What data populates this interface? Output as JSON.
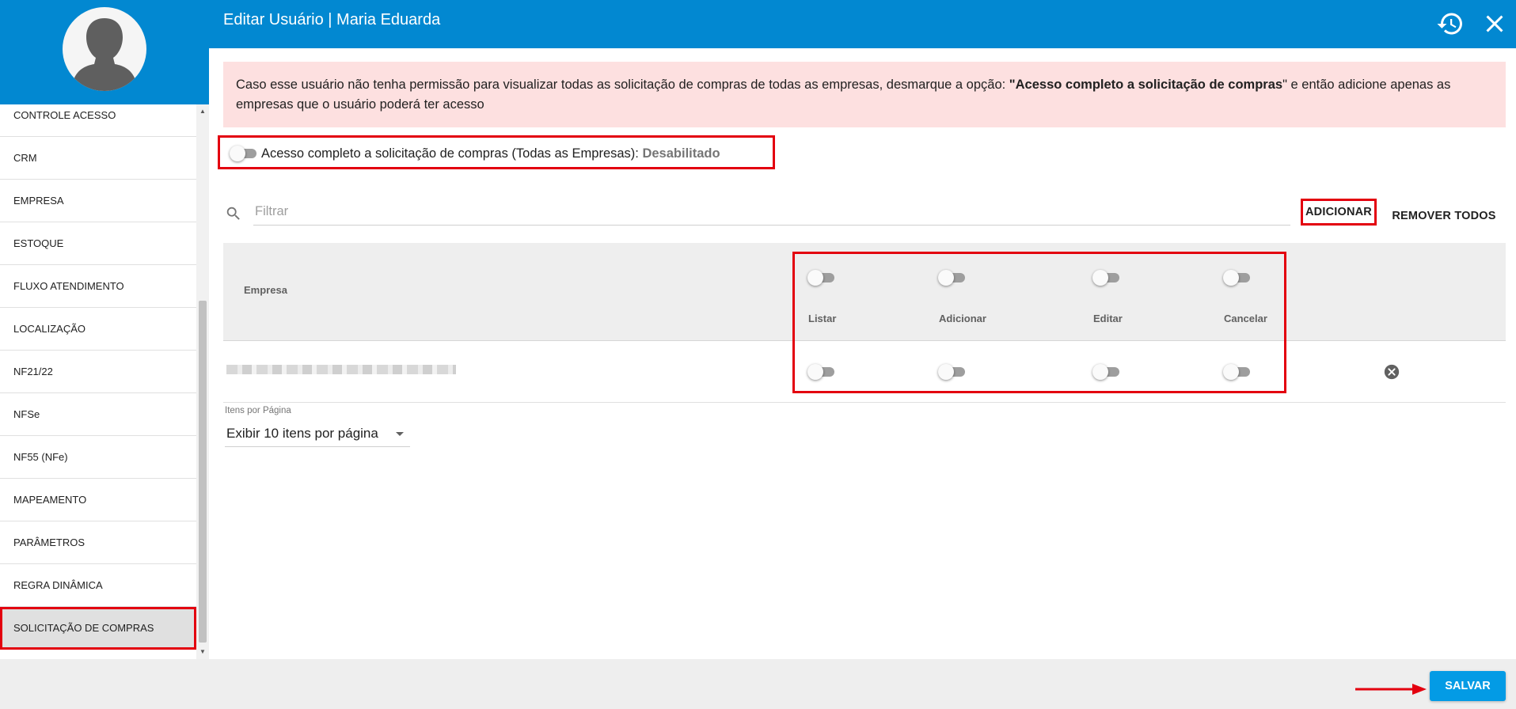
{
  "header": {
    "title": "Editar Usuário | Maria Eduarda",
    "history_icon": "history-icon",
    "close_icon": "close-icon"
  },
  "sidebar": {
    "items": [
      {
        "label": "CONTROLE ACESSO",
        "active": false
      },
      {
        "label": "CRM",
        "active": false
      },
      {
        "label": "EMPRESA",
        "active": false
      },
      {
        "label": "ESTOQUE",
        "active": false
      },
      {
        "label": "FLUXO ATENDIMENTO",
        "active": false
      },
      {
        "label": "LOCALIZAÇÃO",
        "active": false
      },
      {
        "label": "NF21/22",
        "active": false
      },
      {
        "label": "NFSe",
        "active": false
      },
      {
        "label": "NF55 (NFe)",
        "active": false
      },
      {
        "label": "MAPEAMENTO",
        "active": false
      },
      {
        "label": "PARÂMETROS",
        "active": false
      },
      {
        "label": "REGRA DINÂMICA",
        "active": false
      },
      {
        "label": "SOLICITAÇÃO DE COMPRAS",
        "active": true
      }
    ]
  },
  "alert": {
    "text_before": "Caso esse usuário não tenha permissão para visualizar todas as solicitação de compras de todas as empresas, desmarque a opção: ",
    "text_bold": "\"Acesso completo a solicitação de compras",
    "text_after": "\" e então adicione apenas as empresas que o usuário poderá ter acesso"
  },
  "full_access": {
    "label": "Acesso completo a solicitação de compras (Todas as Empresas): ",
    "state": "Desabilitado",
    "enabled": false
  },
  "filter": {
    "placeholder": "Filtrar",
    "value": ""
  },
  "actions": {
    "add_label": "ADICIONAR",
    "remove_all_label": "REMOVER TODOS"
  },
  "table": {
    "company_header": "Empresa",
    "permission_columns": [
      "Listar",
      "Adicionar",
      "Editar",
      "Cancelar"
    ],
    "rows": [
      {
        "company": "",
        "permissions": [
          false,
          false,
          false,
          false
        ]
      }
    ]
  },
  "pager": {
    "label": "Itens por Página",
    "selected": "Exibir 10 itens por página"
  },
  "footer": {
    "save_label": "SALVAR"
  },
  "colors": {
    "primary": "#0288d1",
    "save": "#039be5",
    "highlight": "#e3000f",
    "alert_bg": "#fde0e0"
  }
}
